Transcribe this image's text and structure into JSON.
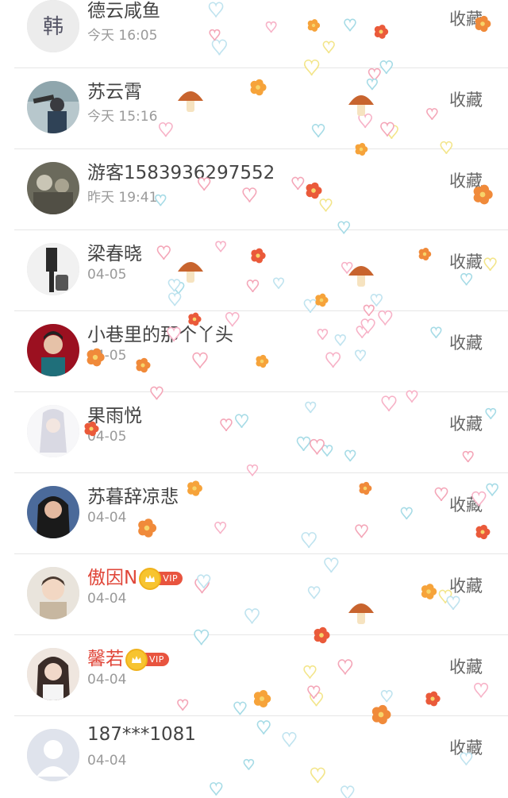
{
  "favorite_label": "收藏",
  "vip_label": "VIP",
  "users": [
    {
      "name": "德云咸鱼",
      "time": "今天 16:05",
      "vip": false,
      "avatar": "calligraphy-avatar"
    },
    {
      "name": "苏云霄",
      "time": "今天 15:16",
      "vip": false,
      "avatar": "photo-avatar"
    },
    {
      "name": "游客1583936297552",
      "time": "昨天 19:41",
      "vip": false,
      "avatar": "photo-avatar"
    },
    {
      "name": "梁春晓",
      "time": "04-05",
      "vip": false,
      "avatar": "photo-avatar"
    },
    {
      "name": "小巷里的那个丫头",
      "time": "04-05",
      "vip": false,
      "avatar": "photo-avatar"
    },
    {
      "name": "果雨悦",
      "time": "04-05",
      "vip": false,
      "avatar": "illustration-avatar"
    },
    {
      "name": "苏暮辞凉悲",
      "time": "04-04",
      "vip": false,
      "avatar": "photo-avatar"
    },
    {
      "name": "傲因N",
      "time": "04-04",
      "vip": true,
      "avatar": "photo-avatar"
    },
    {
      "name": "馨若",
      "time": "04-04",
      "vip": true,
      "avatar": "photo-avatar"
    },
    {
      "name": "187***1081",
      "time": "04-04",
      "vip": false,
      "avatar": "default-avatar"
    }
  ]
}
